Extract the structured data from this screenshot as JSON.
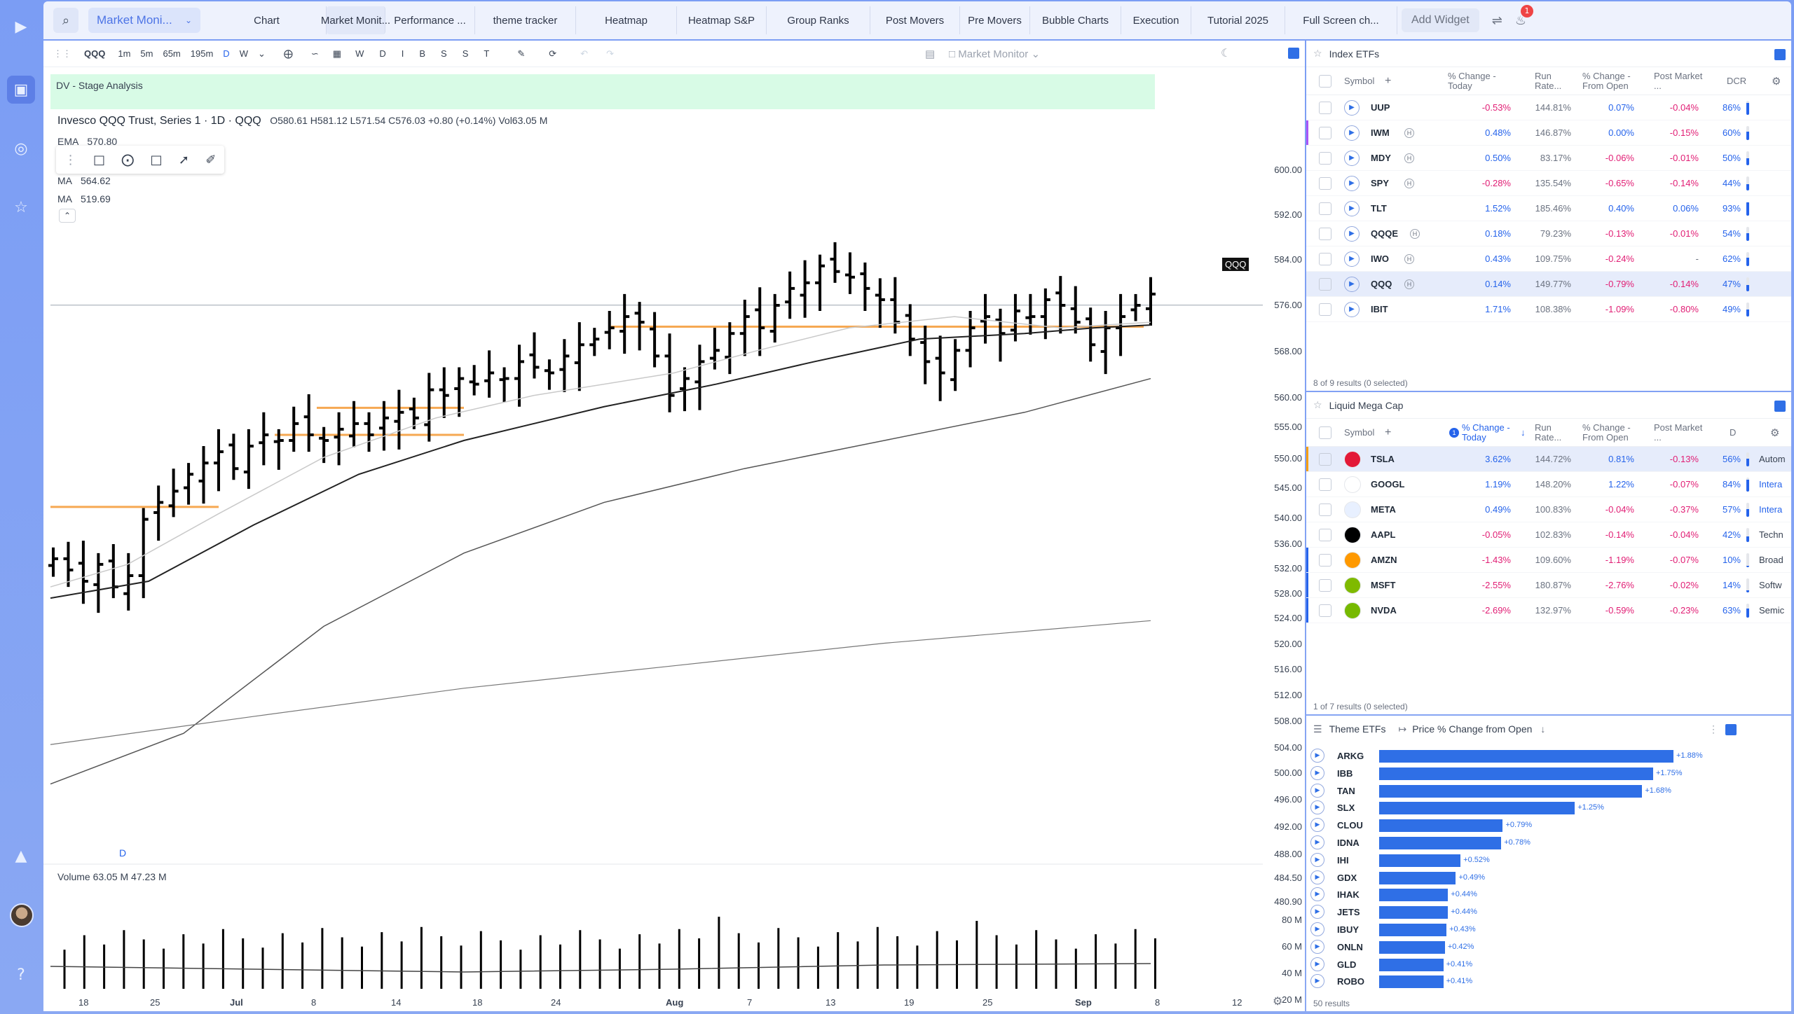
{
  "layout_name": "Market Moni...",
  "tabs": [
    "Chart",
    "Market Monit...",
    "Performance ...",
    "theme tracker",
    "Heatmap",
    "Heatmap S&P",
    "Group Ranks",
    "Post Movers",
    "Pre Movers",
    "Bubble Charts",
    "Execution",
    "Tutorial 2025",
    "Full Screen ch..."
  ],
  "add_widget": "Add Widget",
  "notif_count": "1",
  "chart": {
    "symbol": "QQQ",
    "timeframes": [
      "1m",
      "5m",
      "65m",
      "195m",
      "D",
      "W"
    ],
    "active_tf": "D",
    "letters": [
      "W",
      "D",
      "I",
      "B",
      "S",
      "S",
      "T"
    ],
    "layout_label": "Market Monitor",
    "stage_label": "DV - Stage Analysis",
    "title": "Invesco QQQ Trust, Series 1 · 1D · QQQ",
    "ohlc": "O580.61  H581.12  L571.54  C576.03  +0.80 (+0.14%)  Vol63.05 M",
    "indicators": [
      {
        "name": "EMA",
        "value": "570.80"
      },
      {
        "name": "MA",
        "value": "564.62"
      },
      {
        "name": "MA",
        "value": "519.69"
      }
    ],
    "price_tag": "QQQ",
    "d_marker": "D",
    "price_ticks": [
      "600.00",
      "592.00",
      "584.00",
      "576.00",
      "568.00",
      "560.00",
      "555.00",
      "550.00",
      "545.00",
      "540.00",
      "536.00",
      "532.00",
      "528.00",
      "524.00",
      "520.00",
      "516.00",
      "512.00",
      "508.00",
      "504.00",
      "500.00",
      "496.00",
      "492.00",
      "488.00",
      "484.50",
      "480.90"
    ],
    "date_ticks": [
      "18",
      "25",
      "Jul",
      "8",
      "14",
      "18",
      "24",
      "Aug",
      "7",
      "13",
      "19",
      "25",
      "Sep",
      "8",
      "12"
    ],
    "volume_title": "Volume  63.05 M  47.23 M",
    "volume_ticks": [
      "80 M",
      "60 M",
      "40 M",
      "20 M"
    ]
  },
  "index_etfs": {
    "title": "Index ETFs",
    "columns": [
      "Symbol",
      "% Change - Today",
      "Run Rate...",
      "% Change - From Open",
      "Post Market ...",
      "DCR"
    ],
    "rows": [
      {
        "symbol": "UUP",
        "chg": "-0.53%",
        "run": "144.81%",
        "open": "0.07%",
        "post": "-0.04%",
        "dcr": "86%",
        "dcr_val": 86,
        "h": false,
        "acc": ""
      },
      {
        "symbol": "IWM",
        "chg": "0.48%",
        "run": "146.87%",
        "open": "0.00%",
        "post": "-0.15%",
        "dcr": "60%",
        "dcr_val": 60,
        "h": true,
        "acc": "#a855f7"
      },
      {
        "symbol": "MDY",
        "chg": "0.50%",
        "run": "83.17%",
        "open": "-0.06%",
        "post": "-0.01%",
        "dcr": "50%",
        "dcr_val": 50,
        "h": true,
        "acc": ""
      },
      {
        "symbol": "SPY",
        "chg": "-0.28%",
        "run": "135.54%",
        "open": "-0.65%",
        "post": "-0.14%",
        "dcr": "44%",
        "dcr_val": 44,
        "h": true,
        "acc": ""
      },
      {
        "symbol": "TLT",
        "chg": "1.52%",
        "run": "185.46%",
        "open": "0.40%",
        "post": "0.06%",
        "dcr": "93%",
        "dcr_val": 93,
        "h": false,
        "acc": ""
      },
      {
        "symbol": "QQQE",
        "chg": "0.18%",
        "run": "79.23%",
        "open": "-0.13%",
        "post": "-0.01%",
        "dcr": "54%",
        "dcr_val": 54,
        "h": true,
        "acc": ""
      },
      {
        "symbol": "IWO",
        "chg": "0.43%",
        "run": "109.75%",
        "open": "-0.24%",
        "post": "-",
        "dcr": "62%",
        "dcr_val": 62,
        "h": true,
        "acc": ""
      },
      {
        "symbol": "QQQ",
        "chg": "0.14%",
        "run": "149.77%",
        "open": "-0.79%",
        "post": "-0.14%",
        "dcr": "47%",
        "dcr_val": 47,
        "h": true,
        "acc": "",
        "selected": true
      },
      {
        "symbol": "IBIT",
        "chg": "1.71%",
        "run": "108.38%",
        "open": "-1.09%",
        "post": "-0.80%",
        "dcr": "49%",
        "dcr_val": 49,
        "h": false,
        "acc": ""
      }
    ],
    "footer": "8 of 9 results (0 selected)"
  },
  "mega_cap": {
    "title": "Liquid Mega Cap",
    "columns": [
      "Symbol",
      "% Change - Today",
      "Run Rate...",
      "% Change - From Open",
      "Post Market ...",
      "D"
    ],
    "sort_badge": "1",
    "rows": [
      {
        "symbol": "TSLA",
        "chg": "3.62%",
        "run": "144.72%",
        "open": "0.81%",
        "post": "-0.13%",
        "dcr": "56%",
        "dcr_val": 56,
        "ind": "Autom",
        "ind_blue": false,
        "logo": "#e31937",
        "acc": "#f59e0b",
        "selected": true
      },
      {
        "symbol": "GOOGL",
        "chg": "1.19%",
        "run": "148.20%",
        "open": "1.22%",
        "post": "-0.07%",
        "dcr": "84%",
        "dcr_val": 84,
        "ind": "Intera",
        "ind_blue": true,
        "logo": "#ffffff",
        "acc": ""
      },
      {
        "symbol": "META",
        "chg": "0.49%",
        "run": "100.83%",
        "open": "-0.04%",
        "post": "-0.37%",
        "dcr": "57%",
        "dcr_val": 57,
        "ind": "Intera",
        "ind_blue": true,
        "logo": "#e8f0ff",
        "acc": ""
      },
      {
        "symbol": "AAPL",
        "chg": "-0.05%",
        "run": "102.83%",
        "open": "-0.14%",
        "post": "-0.04%",
        "dcr": "42%",
        "dcr_val": 42,
        "ind": "Techn",
        "ind_blue": false,
        "logo": "#000000",
        "acc": ""
      },
      {
        "symbol": "AMZN",
        "chg": "-1.43%",
        "run": "109.60%",
        "open": "-1.19%",
        "post": "-0.07%",
        "dcr": "10%",
        "dcr_val": 10,
        "ind": "Broad",
        "ind_blue": false,
        "logo": "#ff9900",
        "acc": "#2563eb"
      },
      {
        "symbol": "MSFT",
        "chg": "-2.55%",
        "run": "180.87%",
        "open": "-2.76%",
        "post": "-0.02%",
        "dcr": "14%",
        "dcr_val": 14,
        "ind": "Softw",
        "ind_blue": false,
        "logo": "#7fba00",
        "acc": "#2563eb"
      },
      {
        "symbol": "NVDA",
        "chg": "-2.69%",
        "run": "132.97%",
        "open": "-0.59%",
        "post": "-0.23%",
        "dcr": "63%",
        "dcr_val": 63,
        "ind": "Semic",
        "ind_blue": false,
        "logo": "#76b900",
        "acc": "#2563eb"
      }
    ],
    "footer": "1 of 7 results (0 selected)"
  },
  "theme_etfs": {
    "title": "Theme ETFs",
    "metric": "Price % Change from Open",
    "rows": [
      {
        "name": "ARKG",
        "value": 1.88,
        "label": "+1.88%"
      },
      {
        "name": "IBB",
        "value": 1.75,
        "label": "+1.75%"
      },
      {
        "name": "TAN",
        "value": 1.68,
        "label": "+1.68%"
      },
      {
        "name": "SLX",
        "value": 1.25,
        "label": "+1.25%"
      },
      {
        "name": "CLOU",
        "value": 0.79,
        "label": "+0.79%"
      },
      {
        "name": "IDNA",
        "value": 0.78,
        "label": "+0.78%"
      },
      {
        "name": "IHI",
        "value": 0.52,
        "label": "+0.52%"
      },
      {
        "name": "GDX",
        "value": 0.49,
        "label": "+0.49%"
      },
      {
        "name": "IHAK",
        "value": 0.44,
        "label": "+0.44%"
      },
      {
        "name": "JETS",
        "value": 0.44,
        "label": "+0.44%"
      },
      {
        "name": "IBUY",
        "value": 0.43,
        "label": "+0.43%"
      },
      {
        "name": "ONLN",
        "value": 0.42,
        "label": "+0.42%"
      },
      {
        "name": "GLD",
        "value": 0.41,
        "label": "+0.41%"
      },
      {
        "name": "ROBO",
        "value": 0.41,
        "label": "+0.41%"
      }
    ],
    "footer": "50 results"
  }
}
